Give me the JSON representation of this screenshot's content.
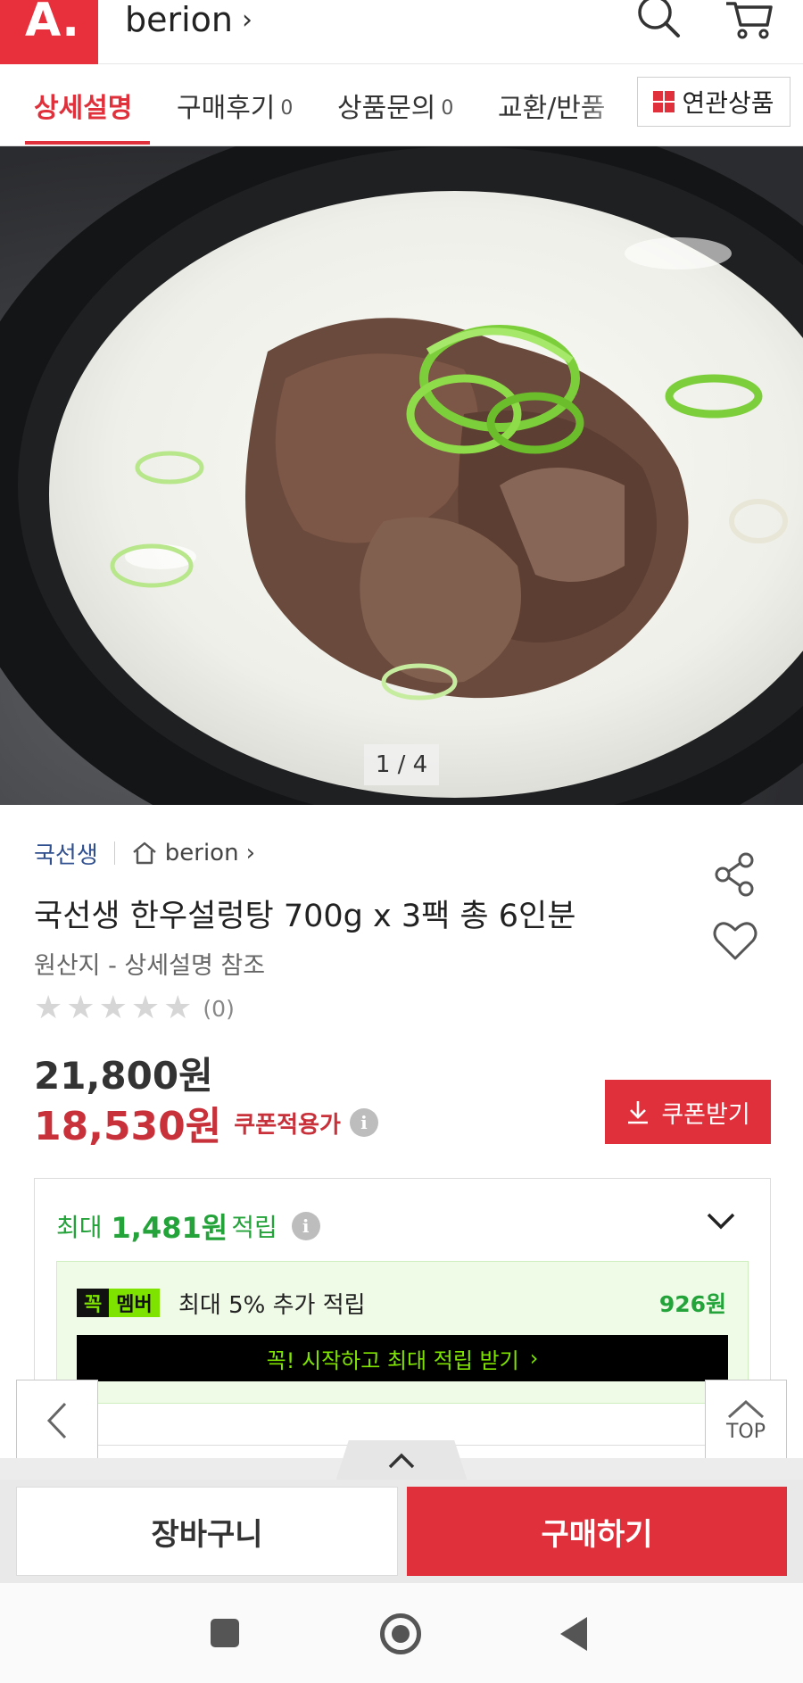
{
  "header": {
    "logo": "A.",
    "store_name": "berion",
    "store_chevron": "›",
    "icons": [
      "search-icon",
      "cart-icon"
    ]
  },
  "tabs": [
    {
      "label": "상세설명",
      "count": "",
      "active": true
    },
    {
      "label": "구매후기",
      "count": "0",
      "active": false
    },
    {
      "label": "상품문의",
      "count": "0",
      "active": false
    },
    {
      "label": "교환/반품",
      "count": "",
      "active": false
    }
  ],
  "related_button": "연관상품",
  "image": {
    "counter": "1 / 4"
  },
  "product": {
    "brand": "국선생",
    "store": "berion",
    "title": "국선생 한우설렁탕 700g x 3팩 총 6인분",
    "origin": "원산지 - 상세설명 참조",
    "rating_stars": 0,
    "rating_count": "(0)",
    "original_price": "21,800원",
    "sale_price": "18,530원",
    "coupon_price_label": "쿠폰적용가",
    "coupon_button": "쿠폰받기"
  },
  "points": {
    "prefix": "최대",
    "amount": "1,481원",
    "suffix": "적립",
    "member_badge_left": "꼭",
    "member_badge_right": "멤버",
    "member_text": "최대 5% 추가 적립",
    "member_amount": "926원",
    "member_cta": "꼭! 시작하고 최대 적립 받기",
    "member_cta_chevron": "›"
  },
  "floating": {
    "top_label": "TOP"
  },
  "bottom": {
    "cart": "장바구니",
    "buy": "구매하기"
  },
  "colors": {
    "accent": "#e0303b",
    "green": "#23a33a",
    "neon": "#7fe300"
  }
}
